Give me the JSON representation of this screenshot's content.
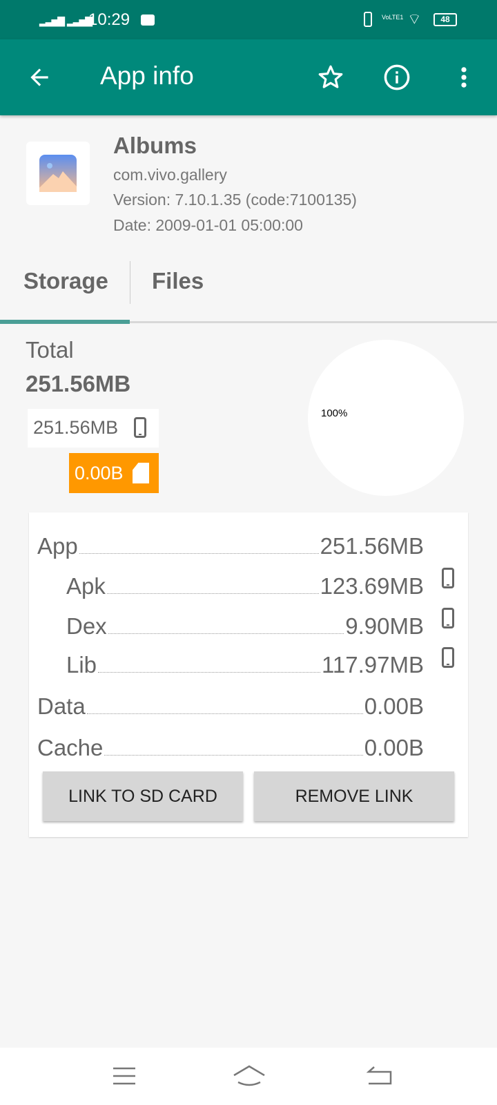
{
  "status_bar": {
    "time": "10:29",
    "battery": "48",
    "network": "VoLTE1",
    "icons": [
      "signal-icon",
      "signal-icon",
      "mail-icon",
      "vibrate-icon",
      "wifi-icon",
      "battery-icon"
    ]
  },
  "toolbar": {
    "title": "App info",
    "icons": [
      "back-arrow-icon",
      "star-icon",
      "info-icon",
      "more-vert-icon"
    ]
  },
  "app": {
    "name": "Albums",
    "package": "com.vivo.gallery",
    "version": "Version: 7.10.1.35 (code:7100135)",
    "date": "Date: 2009-01-01 05:00:00"
  },
  "tabs": [
    {
      "label": "Storage",
      "active": true
    },
    {
      "label": "Files",
      "active": false
    }
  ],
  "storage": {
    "total_label": "Total",
    "total_value": "251.56MB",
    "internal": "251.56MB",
    "sd": "0.00B",
    "pie_label": "100%",
    "pie_percent": 100,
    "rows": [
      {
        "label": "App",
        "value": "251.56MB"
      },
      {
        "label": "Apk",
        "value": "123.69MB"
      },
      {
        "label": "Dex",
        "value": "9.90MB"
      },
      {
        "label": "Lib",
        "value": "117.97MB"
      },
      {
        "label": "Data",
        "value": "0.00B"
      },
      {
        "label": "Cache",
        "value": "0.00B"
      }
    ]
  },
  "buttons": {
    "link": "LINK TO SD CARD",
    "remove": "REMOVE LINK"
  },
  "colors": {
    "primary": "#00897b",
    "status": "#00796b",
    "sd": "#ff9800"
  }
}
